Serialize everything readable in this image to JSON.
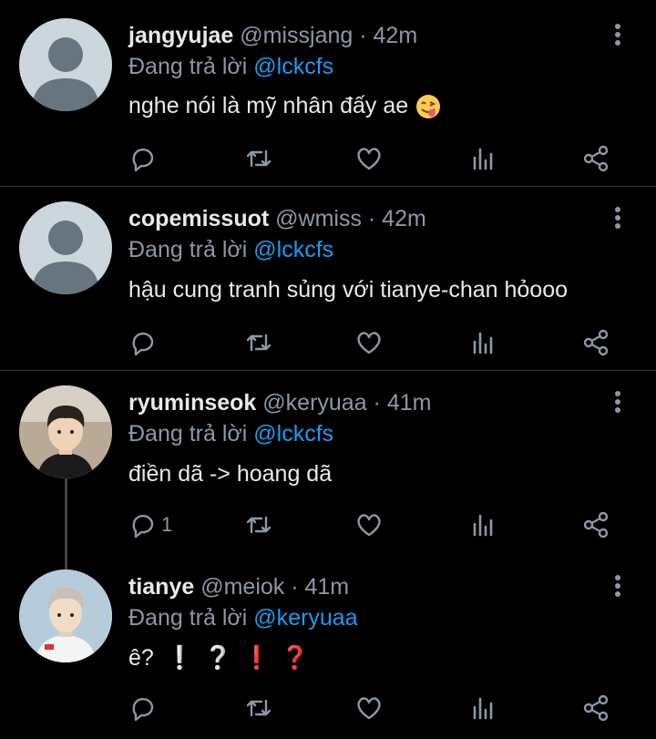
{
  "reply_prefix": "Đang trả lời",
  "tweets": [
    {
      "name": "jangyujae",
      "meta": "@missjang · 42m",
      "reply_to": "@lckcfs",
      "text": "nghe nói là mỹ nhân đấy ae",
      "emoji": "face-savoring-food",
      "avatar": "default-avatar",
      "reply_count": ""
    },
    {
      "name": "copemissuot",
      "meta": "@wmiss · 42m",
      "reply_to": "@lckcfs",
      "text": "hậu cung tranh sủng với tianye-chan hỏooo",
      "avatar": "default-avatar",
      "reply_count": ""
    },
    {
      "name": "ryuminseok",
      "meta": "@keryuaa · 41m",
      "reply_to": "@lckcfs",
      "text": "điền dã -> hoang dã",
      "avatar": "photo-avatar",
      "reply_count": "1"
    },
    {
      "name": "tianye",
      "meta": "@meiok · 41m",
      "reply_to": "@keryuaa",
      "text": "ê?",
      "emoji_marks": [
        "❕",
        "❔",
        "❗",
        "❓"
      ],
      "avatar": "photo-avatar",
      "reply_count": ""
    }
  ],
  "colors": {
    "background": "#000000",
    "text": "#e7e9ea",
    "muted": "#8b98a5",
    "mention": "#1d9bf0",
    "divider": "#2f3336",
    "icon": "#8b98a5"
  },
  "icons": [
    "reply-icon",
    "retweet-icon",
    "like-icon",
    "views-icon",
    "share-icon",
    "more-icon"
  ]
}
